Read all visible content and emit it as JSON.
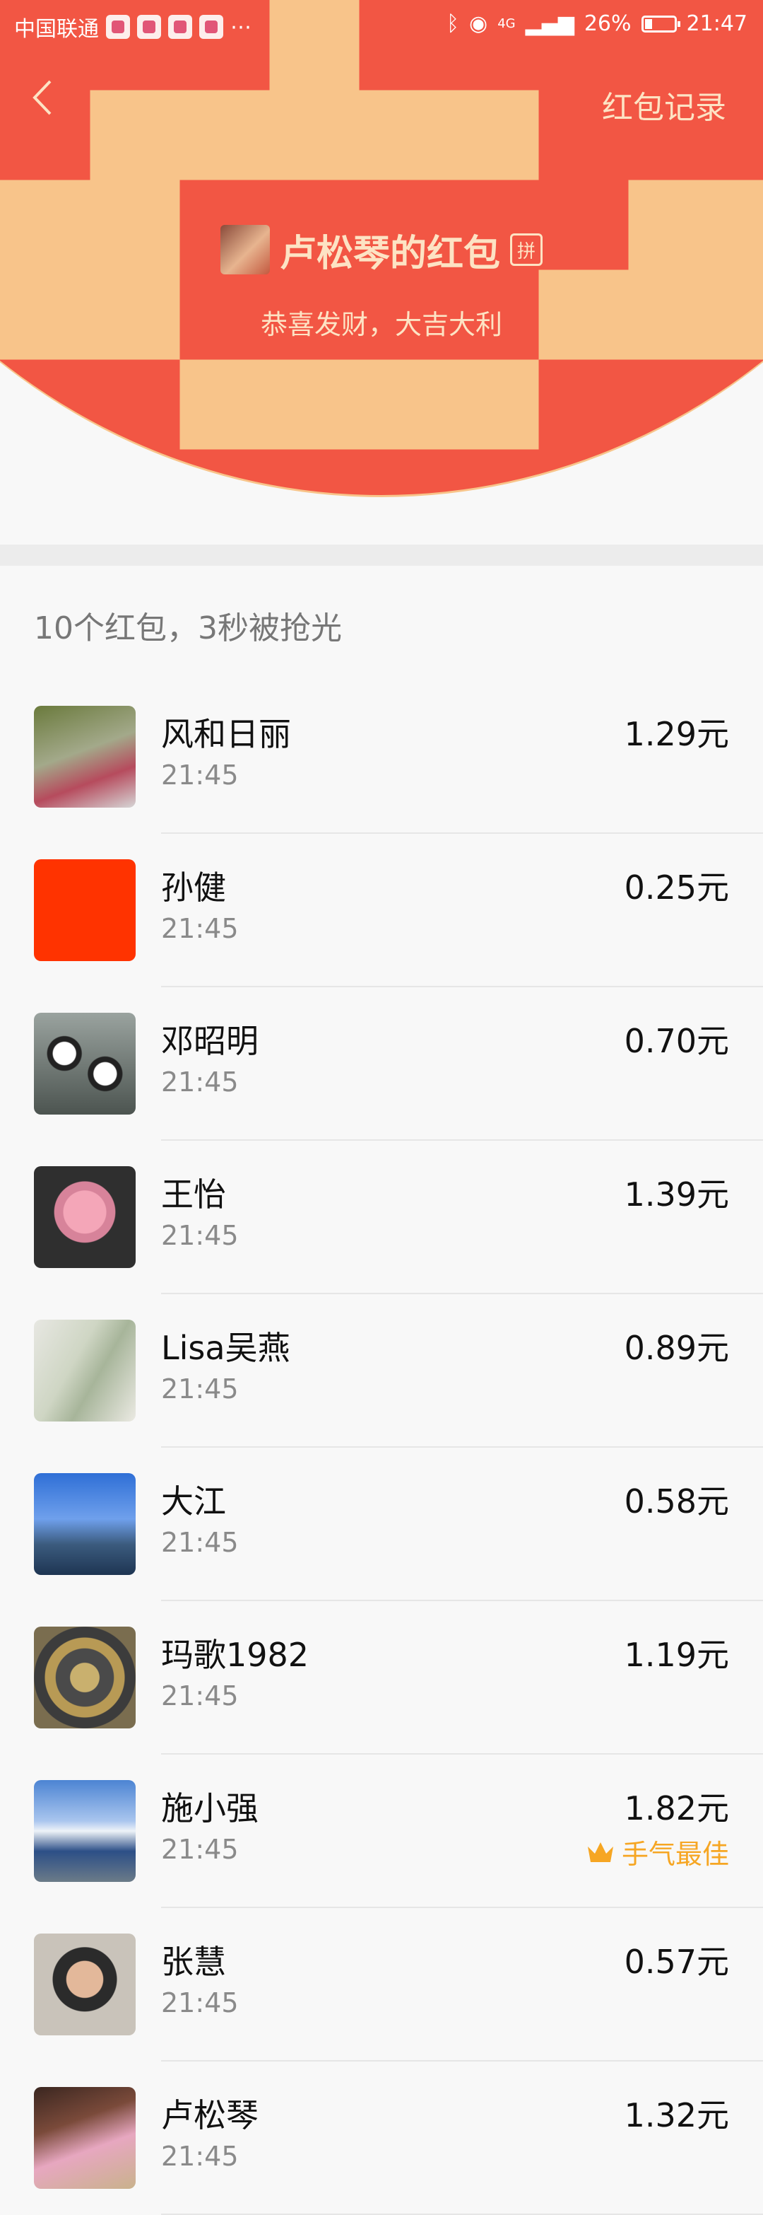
{
  "status_bar": {
    "carrier": "中国联通",
    "network": "4G",
    "battery": "26%",
    "time": "21:47"
  },
  "header": {
    "back_icon": "chevron-left-icon",
    "record_link": "红包记录",
    "sender_title": "卢松琴的红包",
    "badge": "拼",
    "wish": "恭喜发财，大吉大利"
  },
  "summary": "10个红包，3秒被抢光",
  "recipients": [
    {
      "name": "风和日丽",
      "time": "21:45",
      "amount": "1.29元"
    },
    {
      "name": "孙健",
      "time": "21:45",
      "amount": "0.25元"
    },
    {
      "name": "邓昭明",
      "time": "21:45",
      "amount": "0.70元"
    },
    {
      "name": "王怡",
      "time": "21:45",
      "amount": "1.39元"
    },
    {
      "name": "Lisa吴燕",
      "time": "21:45",
      "amount": "0.89元"
    },
    {
      "name": "大江",
      "time": "21:45",
      "amount": "0.58元"
    },
    {
      "name": "玛歌1982",
      "time": "21:45",
      "amount": "1.19元"
    },
    {
      "name": "施小强",
      "time": "21:45",
      "amount": "1.82元",
      "best": "手气最佳"
    },
    {
      "name": "张慧",
      "time": "21:45",
      "amount": "0.57元"
    },
    {
      "name": "卢松琴",
      "time": "21:45",
      "amount": "1.32元"
    }
  ],
  "colors": {
    "header_red": "#f25644",
    "gold_text": "#fde3c4",
    "best_orange": "#f6a623"
  }
}
